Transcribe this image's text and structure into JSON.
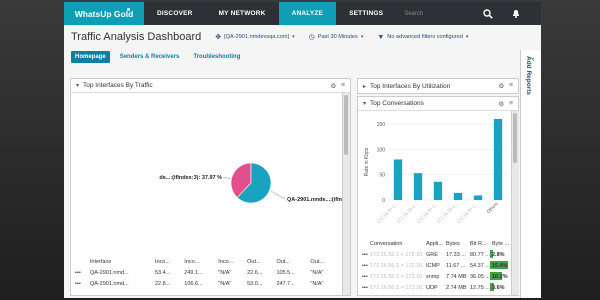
{
  "nav": {
    "logo": "WhatsUp Gold",
    "items": [
      {
        "label": "DISCOVER",
        "active": false
      },
      {
        "label": "MY NETWORK",
        "active": false
      },
      {
        "label": "ANALYZE",
        "active": true
      },
      {
        "label": "SETTINGS",
        "active": false
      }
    ],
    "search_placeholder": "Search",
    "icons": [
      "search-icon",
      "bell-icon"
    ],
    "colors": {
      "bar": "#2d3034",
      "accent": "#0e9fb4"
    }
  },
  "header": {
    "title": "Traffic Analysis Dashboard",
    "source": "[QA-2901.nmdevsqa.com]",
    "time_range": "Past 30 Minutes",
    "filter": "No advanced filters configured"
  },
  "tabs": [
    {
      "label": "Homepage",
      "active": true
    },
    {
      "label": "Senders & Receivers",
      "active": false
    },
    {
      "label": "Troubleshooting",
      "active": false
    }
  ],
  "side_tab": {
    "label": "Add Reports"
  },
  "top_traffic": {
    "title": "Top Interfaces By Traffic",
    "pie": {
      "slices": [
        {
          "label": "de...:(ifIndex:3): 37.97 %",
          "value": 37.97,
          "color": "#e2508b"
        },
        {
          "label": "QA-2901.nmde...:(ifIndex...",
          "value": 62.03,
          "color": "#1aa3c0"
        }
      ]
    },
    "table": {
      "headers": [
        "",
        "Interface",
        "Inco...",
        "Inco...",
        "Inco...",
        "Out...",
        "Out...",
        "Out..."
      ],
      "rows": [
        [
          "•••",
          "QA-2901.nmd...",
          "53.4...",
          "249.1...",
          "\"N/A\"",
          "22.6...",
          "105.5...",
          "\"N/A\""
        ],
        [
          "•••",
          "QA-2901.nmd...",
          "22.8...",
          "106.6...",
          "\"N/A\"",
          "53.0...",
          "247.7...",
          "\"N/A\""
        ]
      ]
    }
  },
  "top_utilization": {
    "title": "Top Interfaces By Utilization"
  },
  "top_conversations": {
    "title": "Top Conversations",
    "chart_data": {
      "type": "bar",
      "ylabel": "Rate in Kbps",
      "ylim": [
        0,
        150
      ],
      "yticks": [
        0,
        50,
        100,
        150
      ],
      "categories": [
        "172.16.56.1...",
        "172.16.56.1...",
        "172.16.56.1...",
        "172.16.56.1...",
        "172.16.56.1...",
        "Others"
      ],
      "values": [
        80,
        53,
        36,
        14,
        9,
        160
      ],
      "color": "#1aa3c0"
    },
    "table": {
      "headers": [
        "",
        "Conversation",
        "Appli...",
        "Bytes",
        "Bit R...",
        "Byte ..."
      ],
      "rows": [
        {
          "dots": "•••",
          "conversation": "172.16.56.1 > 172.16.56.1...",
          "app": "GRE",
          "bytes": "17.33 ...",
          "bitrate": "80.77 ...",
          "pct": "2.8%",
          "pct_value": 2.8
        },
        {
          "dots": "•••",
          "conversation": "172.16.56.1 > 172.16.56.1...",
          "app": "ICMP",
          "bytes": "11.67 ...",
          "bitrate": "54.37 ...",
          "pct": "15.4%",
          "pct_value": 15.4
        },
        {
          "dots": "•••",
          "conversation": "172.16.56.1 > 172.16.56.1...",
          "app": "snmp",
          "bytes": "7.74 MB",
          "bitrate": "36.05 ...",
          "pct": "10.2%",
          "pct_value": 10.2
        },
        {
          "dots": "•••",
          "conversation": "172.16.56.1 > 172.16.56.1flow...",
          "app": "UDP",
          "bytes": "2.74 MB",
          "bitrate": "12.75 ...",
          "pct": "3.6%",
          "pct_value": 3.6
        }
      ]
    }
  }
}
